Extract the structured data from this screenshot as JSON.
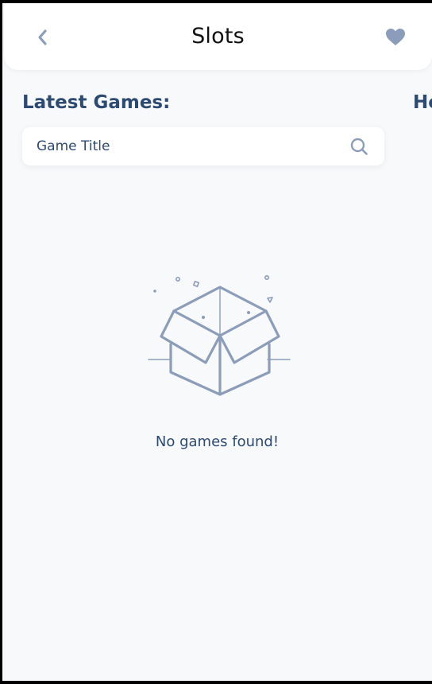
{
  "header": {
    "title": "Slots",
    "back_icon": "chevron-left-icon",
    "favorite_icon": "heart-icon"
  },
  "sections": {
    "latest_label": "Latest Games:",
    "next_label_partial": "Ho"
  },
  "search": {
    "placeholder": "Game Title",
    "value": "",
    "icon": "search-icon"
  },
  "empty_state": {
    "icon": "empty-box-icon",
    "message": "No games found!"
  },
  "colors": {
    "primary_text": "#2c4a72",
    "icon_muted": "#8b9dba",
    "background": "#f8f9fa",
    "card": "#ffffff"
  }
}
